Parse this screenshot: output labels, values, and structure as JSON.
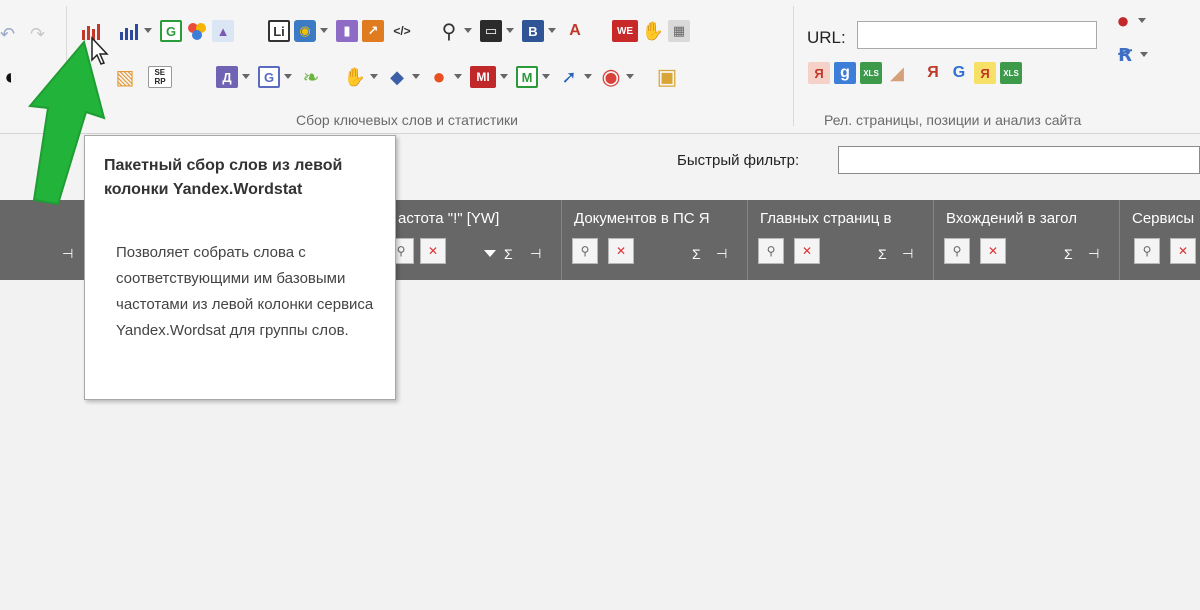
{
  "ribbon": {
    "group_keywords_label": "Сбор ключевых слов и статистики",
    "group_site_label": "Рел. страницы, позиции и анализ сайта",
    "url_label": "URL:",
    "url_value": "",
    "icons_row1": [
      {
        "name": "wordstat-batch-icon",
        "glyph": "▮"
      },
      {
        "name": "bar-chart-icon",
        "glyph": "▮"
      },
      {
        "name": "google-g-icon",
        "glyph": "G"
      },
      {
        "name": "colored-circles-icon",
        "glyph": "●"
      },
      {
        "name": "image-chart-icon",
        "glyph": "▲"
      },
      {
        "name": "li-counter-icon",
        "glyph": "Li"
      },
      {
        "name": "web-circle-icon",
        "glyph": "◉"
      },
      {
        "name": "purple-chart-icon",
        "glyph": "▮"
      },
      {
        "name": "orange-trend-icon",
        "glyph": "↗"
      },
      {
        "name": "code-tag-icon",
        "glyph": "</>"
      },
      {
        "name": "magnifier-icon",
        "glyph": "🔍"
      },
      {
        "name": "monitor-chart-icon",
        "glyph": "▭"
      },
      {
        "name": "b-letter-icon",
        "glyph": "B"
      },
      {
        "name": "spellcheck-icon",
        "glyph": "A"
      },
      {
        "name": "we-logo-icon",
        "glyph": "WE"
      },
      {
        "name": "hand-icon",
        "glyph": "✋"
      },
      {
        "name": "calculator-icon",
        "glyph": "▦"
      }
    ],
    "icons_row2": [
      {
        "name": "half-circle-icon",
        "glyph": "◐"
      },
      {
        "name": "map-icon",
        "glyph": "▧"
      },
      {
        "name": "serp-icon",
        "glyph": "SE RP"
      },
      {
        "name": "d-letter-icon",
        "glyph": "Д"
      },
      {
        "name": "google-g-box-icon",
        "glyph": "G"
      },
      {
        "name": "leaf-icon",
        "glyph": "❧"
      },
      {
        "name": "orange-hand-icon",
        "glyph": "✋"
      },
      {
        "name": "spy-hat-icon",
        "glyph": "◆"
      },
      {
        "name": "fire-ball-icon",
        "glyph": "●"
      },
      {
        "name": "mi-logo-icon",
        "glyph": "MI"
      },
      {
        "name": "m-green-icon",
        "glyph": "M"
      },
      {
        "name": "blue-arrow-icon",
        "glyph": "➚"
      },
      {
        "name": "red-circle-icon",
        "glyph": "◉"
      },
      {
        "name": "box-icon",
        "glyph": "▣"
      }
    ],
    "icons_site": [
      {
        "name": "yandex-ya-icon",
        "glyph": "Я"
      },
      {
        "name": "google-8-icon",
        "glyph": "g"
      },
      {
        "name": "xls-export-icon",
        "glyph": "XLS"
      },
      {
        "name": "eraser-icon",
        "glyph": "◢"
      },
      {
        "name": "yandex-rel-icon",
        "glyph": "Я"
      },
      {
        "name": "google-rel-icon",
        "glyph": "G"
      },
      {
        "name": "yandex-yellow-icon",
        "glyph": "Я"
      },
      {
        "name": "xls-green-icon",
        "glyph": "XLS"
      }
    ]
  },
  "filter": {
    "label": "Быстрый фильтр:",
    "value": ""
  },
  "grid": {
    "columns": [
      {
        "title": "астота \"!\" [YW]"
      },
      {
        "title": "Документов в ПС Я"
      },
      {
        "title": "Главных страниц в"
      },
      {
        "title": "Вхождений в загол"
      },
      {
        "title": "Сервисы"
      }
    ],
    "sigma": "Σ",
    "pin": "⊣"
  },
  "tooltip": {
    "title": "Пакетный сбор слов из левой колонки Yandex.Wordstat",
    "body": "Позволяет собрать слова с соответствующими им базовыми частотами из левой колонки сервиса Yandex.Wordsat для группы слов."
  }
}
